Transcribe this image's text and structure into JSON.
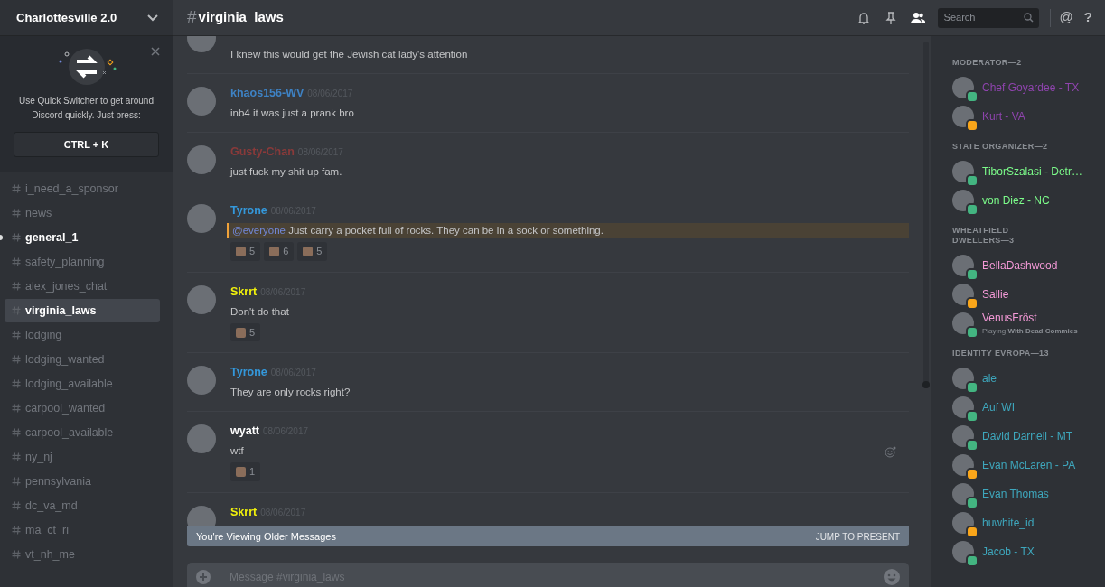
{
  "server": {
    "name": "Charlottesville 2.0"
  },
  "quick_switcher": {
    "text": "Use Quick Switcher to get around Discord quickly. Just press:",
    "shortcut": "CTRL + K"
  },
  "channels": [
    {
      "name": "i_need_a_sponsor",
      "selected": false,
      "unread": false
    },
    {
      "name": "news",
      "selected": false,
      "unread": false
    },
    {
      "name": "general_1",
      "selected": false,
      "unread": true
    },
    {
      "name": "safety_planning",
      "selected": false,
      "unread": false
    },
    {
      "name": "alex_jones_chat",
      "selected": false,
      "unread": false
    },
    {
      "name": "virginia_laws",
      "selected": true,
      "unread": false
    },
    {
      "name": "lodging",
      "selected": false,
      "unread": false
    },
    {
      "name": "lodging_wanted",
      "selected": false,
      "unread": false
    },
    {
      "name": "lodging_available",
      "selected": false,
      "unread": false
    },
    {
      "name": "carpool_wanted",
      "selected": false,
      "unread": false
    },
    {
      "name": "carpool_available",
      "selected": false,
      "unread": false
    },
    {
      "name": "ny_nj",
      "selected": false,
      "unread": false
    },
    {
      "name": "pennsylvania",
      "selected": false,
      "unread": false
    },
    {
      "name": "dc_va_md",
      "selected": false,
      "unread": false
    },
    {
      "name": "ma_ct_ri",
      "selected": false,
      "unread": false
    },
    {
      "name": "vt_nh_me",
      "selected": false,
      "unread": false
    }
  ],
  "header": {
    "hash": "#",
    "channel": "virginia_laws",
    "search_placeholder": "Search",
    "mentions": "@",
    "help": "?"
  },
  "messages": [
    {
      "text": "I knew this would get the Jewish cat lady's attention"
    },
    {
      "author": "khaos156-WV",
      "color": "#3e82c4",
      "time": "08/06/2017",
      "text": "inb4 it was just a prank bro"
    },
    {
      "author": "Gusty-Chan",
      "color": "#8a3a3a",
      "time": "08/06/2017",
      "text": "just fuck my shit up fam."
    },
    {
      "author": "Tyrone",
      "color": "#3498db",
      "time": "08/06/2017",
      "mention": "@everyone",
      "text": "Just carry a pocket full of rocks. They can be in a sock or something.",
      "reactions": [
        {
          "count": "5"
        },
        {
          "count": "6"
        },
        {
          "count": "5"
        }
      ]
    },
    {
      "author": "Skrrt",
      "color": "#f1f10c",
      "time": "08/06/2017",
      "text": "Don't do that",
      "reactions": [
        {
          "count": "5"
        }
      ]
    },
    {
      "author": "Tyrone",
      "color": "#3498db",
      "time": "08/06/2017",
      "text": "They are only rocks right?"
    },
    {
      "author": "wyatt",
      "color": "#ffffff",
      "time": "08/06/2017",
      "text": "wtf",
      "reactions": [
        {
          "count": "1"
        }
      ]
    },
    {
      "author": "Skrrt",
      "color": "#f1f10c",
      "time": "08/06/2017"
    }
  ],
  "older_bar": {
    "text": "You're Viewing Older Messages",
    "action": "JUMP TO PRESENT"
  },
  "composer": {
    "placeholder": "Message #virginia_laws"
  },
  "member_groups": [
    {
      "title": "MODERATOR—2",
      "color": "#8e44ad",
      "members": [
        {
          "name": "Chef Goyardee - TX",
          "color": "#43b581"
        },
        {
          "name": "Kurt - VA",
          "color": "#faa61a"
        }
      ]
    },
    {
      "title": "STATE ORGANIZER—2",
      "color": "#7cfc8a",
      "members": [
        {
          "name": "TiborSzalasi - Detr…",
          "color": "#43b581"
        },
        {
          "name": "von Diez - NC",
          "color": "#43b581"
        }
      ]
    },
    {
      "title": "WHEATFIELD DWELLERS—3",
      "color": "#f59ad8",
      "members": [
        {
          "name": "BellaDashwood",
          "color": "#43b581"
        },
        {
          "name": "Sallie",
          "color": "#faa61a"
        },
        {
          "name": "VenusFröst",
          "color": "#43b581",
          "activity": "Playing **With Dead Commies**"
        }
      ]
    },
    {
      "title": "IDENTITY EVROPA—13",
      "color": "#3ea7bd",
      "members": [
        {
          "name": "ale",
          "color": "#43b581"
        },
        {
          "name": "Auf WI",
          "color": "#43b581"
        },
        {
          "name": "David Darnell - MT",
          "color": "#43b581"
        },
        {
          "name": "Evan McLaren - PA",
          "color": "#faa61a"
        },
        {
          "name": "Evan Thomas",
          "color": "#43b581"
        },
        {
          "name": "huwhite_id",
          "color": "#faa61a"
        },
        {
          "name": "Jacob - TX",
          "color": "#43b581"
        }
      ]
    }
  ]
}
